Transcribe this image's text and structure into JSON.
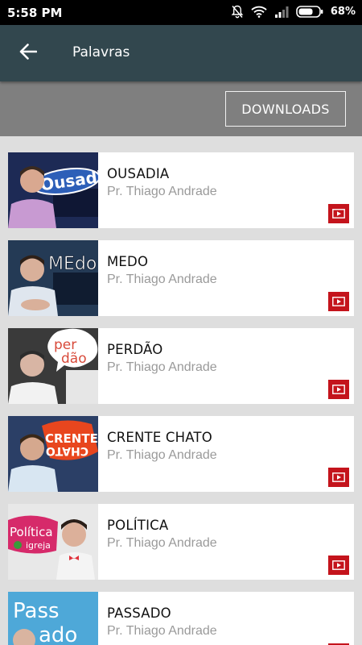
{
  "status_bar": {
    "time": "5:58 PM",
    "battery_percent": "68%",
    "icons": [
      "notifications-off-icon",
      "wifi-icon",
      "signal-icon",
      "battery-icon"
    ]
  },
  "app_bar": {
    "back_icon": "arrow-back-icon",
    "title": "Palavras"
  },
  "actions": {
    "downloads_label": "DOWNLOADS"
  },
  "videos": [
    {
      "title": "OUSADIA",
      "author": "Pr. Thiago Andrade",
      "thumb_word": "Ousadia",
      "thumb_bg": "#1d2a55",
      "thumb_word_color": "#ffffff",
      "thumb_word_bg": "#2d5fb8",
      "badge_icon": "youtube-play-icon"
    },
    {
      "title": "MEDO",
      "author": "Pr. Thiago Andrade",
      "thumb_word": "MEdo",
      "thumb_bg": "#243a55",
      "thumb_word_color": "#ffffff",
      "thumb_word_bg": "#2b4a6a",
      "badge_icon": "youtube-play-icon"
    },
    {
      "title": "PERDÃO",
      "author": "Pr. Thiago Andrade",
      "thumb_word": "per dão",
      "thumb_bg": "#3a3a3a",
      "thumb_word_color": "#d84a3a",
      "thumb_word_bg": "#ffffff",
      "badge_icon": "youtube-play-icon"
    },
    {
      "title": "CRENTE CHATO",
      "author": "Pr. Thiago Andrade",
      "thumb_word": "CRENTE",
      "thumb_bg": "#2b3f66",
      "thumb_word_color": "#ffffff",
      "thumb_word_bg": "#e8461e",
      "badge_icon": "youtube-play-icon"
    },
    {
      "title": "POLÍTICA",
      "author": "Pr. Thiago Andrade",
      "thumb_word": "Política",
      "thumb_bg": "#e8e8e8",
      "thumb_word_color": "#ffffff",
      "thumb_word_bg": "#d62a6a",
      "badge_icon": "youtube-play-icon"
    },
    {
      "title": "PASSADO",
      "author": "Pr. Thiago Andrade",
      "thumb_word": "Pass ado",
      "thumb_bg": "#4ea8d8",
      "thumb_word_color": "#ffffff",
      "thumb_word_bg": "#3b9ad6",
      "badge_icon": "youtube-play-icon"
    }
  ],
  "colors": {
    "app_bar": "#32474e",
    "action_band": "#7f7f7f",
    "list_bg": "#dedede",
    "badge_red": "#c4141c",
    "author_gray": "#9a9a9a"
  }
}
